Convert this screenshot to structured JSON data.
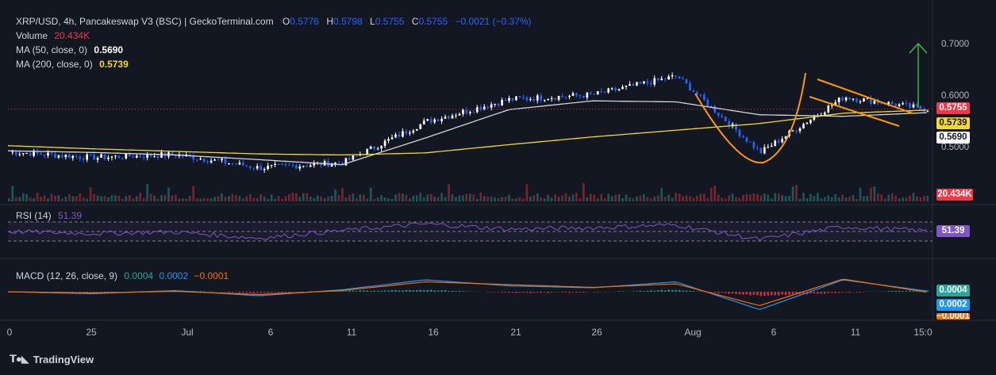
{
  "header": {
    "symbol": "XRP/USD, 4h, Pancakeswap V3 (BSC) | GeckoTerminal.com",
    "o_label": "O",
    "o_value": "0.5776",
    "h_label": "H",
    "h_value": "0.5798",
    "l_label": "L",
    "l_value": "0.5755",
    "c_label": "C",
    "c_value": "0.5755",
    "change": "−0.0021 (−0.37%)"
  },
  "legend": {
    "volume_label": "Volume",
    "volume_value": "20.434K",
    "ma50_label": "MA (50, close, 0)",
    "ma50_value": "0.5690",
    "ma200_label": "MA (200, close, 0)",
    "ma200_value": "0.5739",
    "rsi_label": "RSI (14)",
    "rsi_value": "51.39",
    "macd_label": "MACD (12, 26, close, 9)",
    "macd_hist": "0.0004",
    "macd_line": "0.0002",
    "macd_signal": "−0.0001"
  },
  "price_axis": [
    "0.7000",
    "0.6000",
    "0.5000"
  ],
  "badges": {
    "last_price": "0.5755",
    "ma200": "0.5739",
    "ma50": "0.5690",
    "volume": "20.434K",
    "rsi": "51.39",
    "macd_hist": "0.0004",
    "macd_line": "0.0002",
    "macd_signal": "−0.0001"
  },
  "time_axis": [
    "0",
    "25",
    "Jul",
    "6",
    "11",
    "16",
    "21",
    "26",
    "Aug",
    "6",
    "11",
    "15:0"
  ],
  "footer": {
    "brand": "TradingView"
  },
  "colors": {
    "background": "#131722",
    "up": "#ffffff",
    "down": "#2962ff",
    "ma50": "#d1d4dc",
    "ma200": "#f7d82b",
    "pattern": "#ff9800",
    "arrow": "#4caf50",
    "rsi": "#7e57c2",
    "macd_line": "#2196f3",
    "signal_line": "#ff6d00"
  },
  "chart_data": [
    {
      "type": "line",
      "title": "XRP/USD, 4h, Pancakeswap V3 (BSC)",
      "ylabel": "",
      "ylim": [
        0.44,
        0.72
      ],
      "x": [
        "Jun 20",
        "Jun 25",
        "Jul 1",
        "Jul 6",
        "Jul 11",
        "Jul 16",
        "Jul 21",
        "Jul 26",
        "Aug 1",
        "Aug 6",
        "Aug 11",
        "Aug 14"
      ],
      "series": [
        {
          "name": "MA (50, close, 0)",
          "values": [
            0.495,
            0.492,
            0.487,
            0.478,
            0.468,
            0.52,
            0.575,
            0.592,
            0.59,
            0.565,
            0.562,
            0.569
          ]
        },
        {
          "name": "MA (200, close, 0)",
          "values": [
            0.505,
            0.499,
            0.494,
            0.489,
            0.487,
            0.491,
            0.507,
            0.522,
            0.535,
            0.548,
            0.568,
            0.574
          ]
        }
      ],
      "close_series": [
        0.493,
        0.482,
        0.488,
        0.462,
        0.472,
        0.552,
        0.595,
        0.604,
        0.64,
        0.492,
        0.6,
        0.5755
      ],
      "last_price": 0.5755
    },
    {
      "type": "line",
      "title": "RSI (14)",
      "ylim": [
        0,
        100
      ],
      "series": [
        {
          "name": "RSI (14)",
          "values": [
            50,
            46,
            49,
            36,
            52,
            66,
            55,
            58,
            64,
            33,
            60,
            51.39
          ]
        }
      ]
    },
    {
      "type": "line",
      "title": "MACD (12, 26, close, 9)",
      "series": [
        {
          "name": "MACD",
          "values": [
            0.0,
            -0.0005,
            0.0003,
            -0.001,
            0.0005,
            0.003,
            0.0015,
            0.001,
            0.0025,
            -0.0045,
            0.003,
            0.0002
          ]
        },
        {
          "name": "Signal",
          "values": [
            0.0,
            -0.0003,
            0.0001,
            -0.0007,
            0.0003,
            0.0025,
            0.0018,
            0.0011,
            0.002,
            -0.0035,
            0.0032,
            -0.0001
          ]
        },
        {
          "name": "Histogram",
          "values": [
            0.0,
            -0.0002,
            0.0002,
            -0.0003,
            0.0002,
            0.0005,
            -0.0003,
            -0.0001,
            0.0005,
            -0.001,
            -0.0002,
            0.0004
          ]
        }
      ]
    }
  ]
}
